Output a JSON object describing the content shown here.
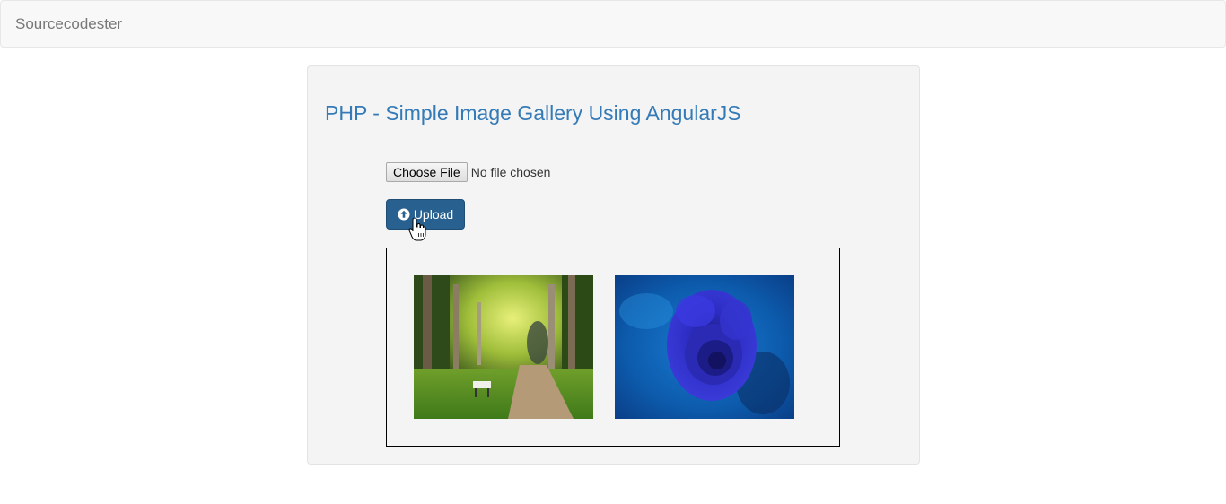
{
  "navbar": {
    "brand": "Sourcecodester"
  },
  "main": {
    "title": "PHP - Simple Image Gallery Using AngularJS",
    "file_input": {
      "button_label": "Choose File",
      "status": "No file chosen"
    },
    "upload_button": {
      "label": "Upload",
      "icon": "circle-arrow-up-icon",
      "color": "#286090"
    },
    "gallery": {
      "images": [
        {
          "subject": "forest-path-with-bench"
        },
        {
          "subject": "blue-rose-with-dewdrops"
        }
      ]
    }
  },
  "colors": {
    "title": "#337ab7",
    "navbar_bg": "#f8f8f8",
    "well_bg": "#f4f4f4",
    "brand_text": "#777777"
  }
}
